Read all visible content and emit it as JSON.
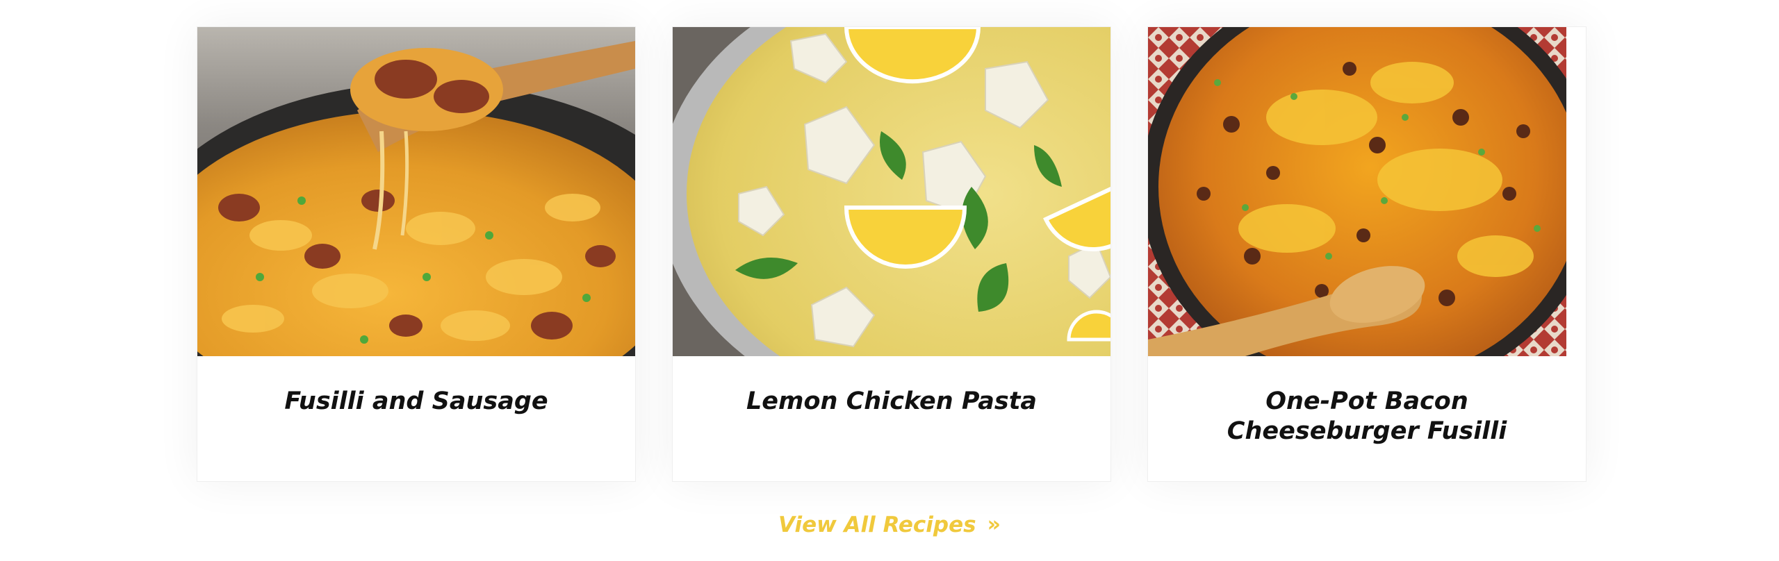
{
  "recipes": [
    {
      "title": "Fusilli and Sausage",
      "image": "skillet pasta with sausage"
    },
    {
      "title": "Lemon Chicken Pasta",
      "image": "fusilli with chicken, lemon and basil"
    },
    {
      "title": "One-Pot Bacon Cheeseburger Fusilli",
      "image": "cheesy beef fusilli with wooden spoon"
    }
  ],
  "view_all": {
    "label": "View All Recipes",
    "icon": "double-chevron-right-icon"
  },
  "colors": {
    "accent": "#F0C93C",
    "title": "#111111",
    "card_border": "#EFEFEF"
  }
}
